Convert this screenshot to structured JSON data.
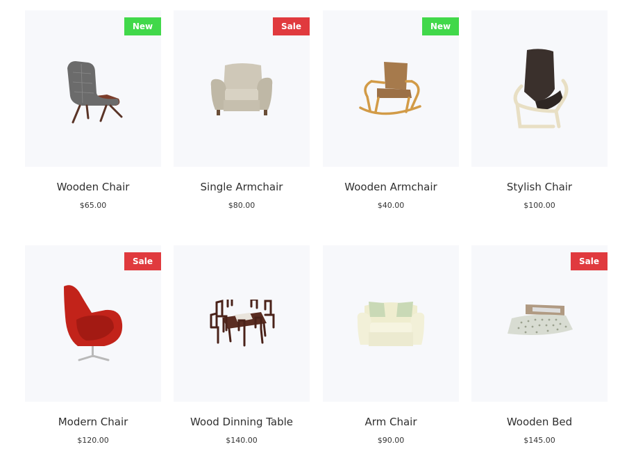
{
  "products": [
    {
      "title": "Wooden Chair",
      "price": "$65.00",
      "badge": "New",
      "badge_type": "new",
      "icon": "lounge-chair-icon"
    },
    {
      "title": "Single Armchair",
      "price": "$80.00",
      "badge": "Sale",
      "badge_type": "sale",
      "icon": "armchair-icon"
    },
    {
      "title": "Wooden Armchair",
      "price": "$40.00",
      "badge": "New",
      "badge_type": "new",
      "icon": "rocking-chair-icon"
    },
    {
      "title": "Stylish Chair",
      "price": "$100.00",
      "badge": "",
      "badge_type": "",
      "icon": "poang-chair-icon"
    },
    {
      "title": "Modern Chair",
      "price": "$120.00",
      "badge": "Sale",
      "badge_type": "sale",
      "icon": "egg-chair-icon"
    },
    {
      "title": "Wood Dinning Table",
      "price": "$140.00",
      "badge": "",
      "badge_type": "",
      "icon": "dining-set-icon"
    },
    {
      "title": "Arm Chair",
      "price": "$90.00",
      "badge": "",
      "badge_type": "",
      "icon": "loveseat-icon"
    },
    {
      "title": "Wooden Bed",
      "price": "$145.00",
      "badge": "Sale",
      "badge_type": "sale",
      "icon": "bed-icon"
    }
  ]
}
